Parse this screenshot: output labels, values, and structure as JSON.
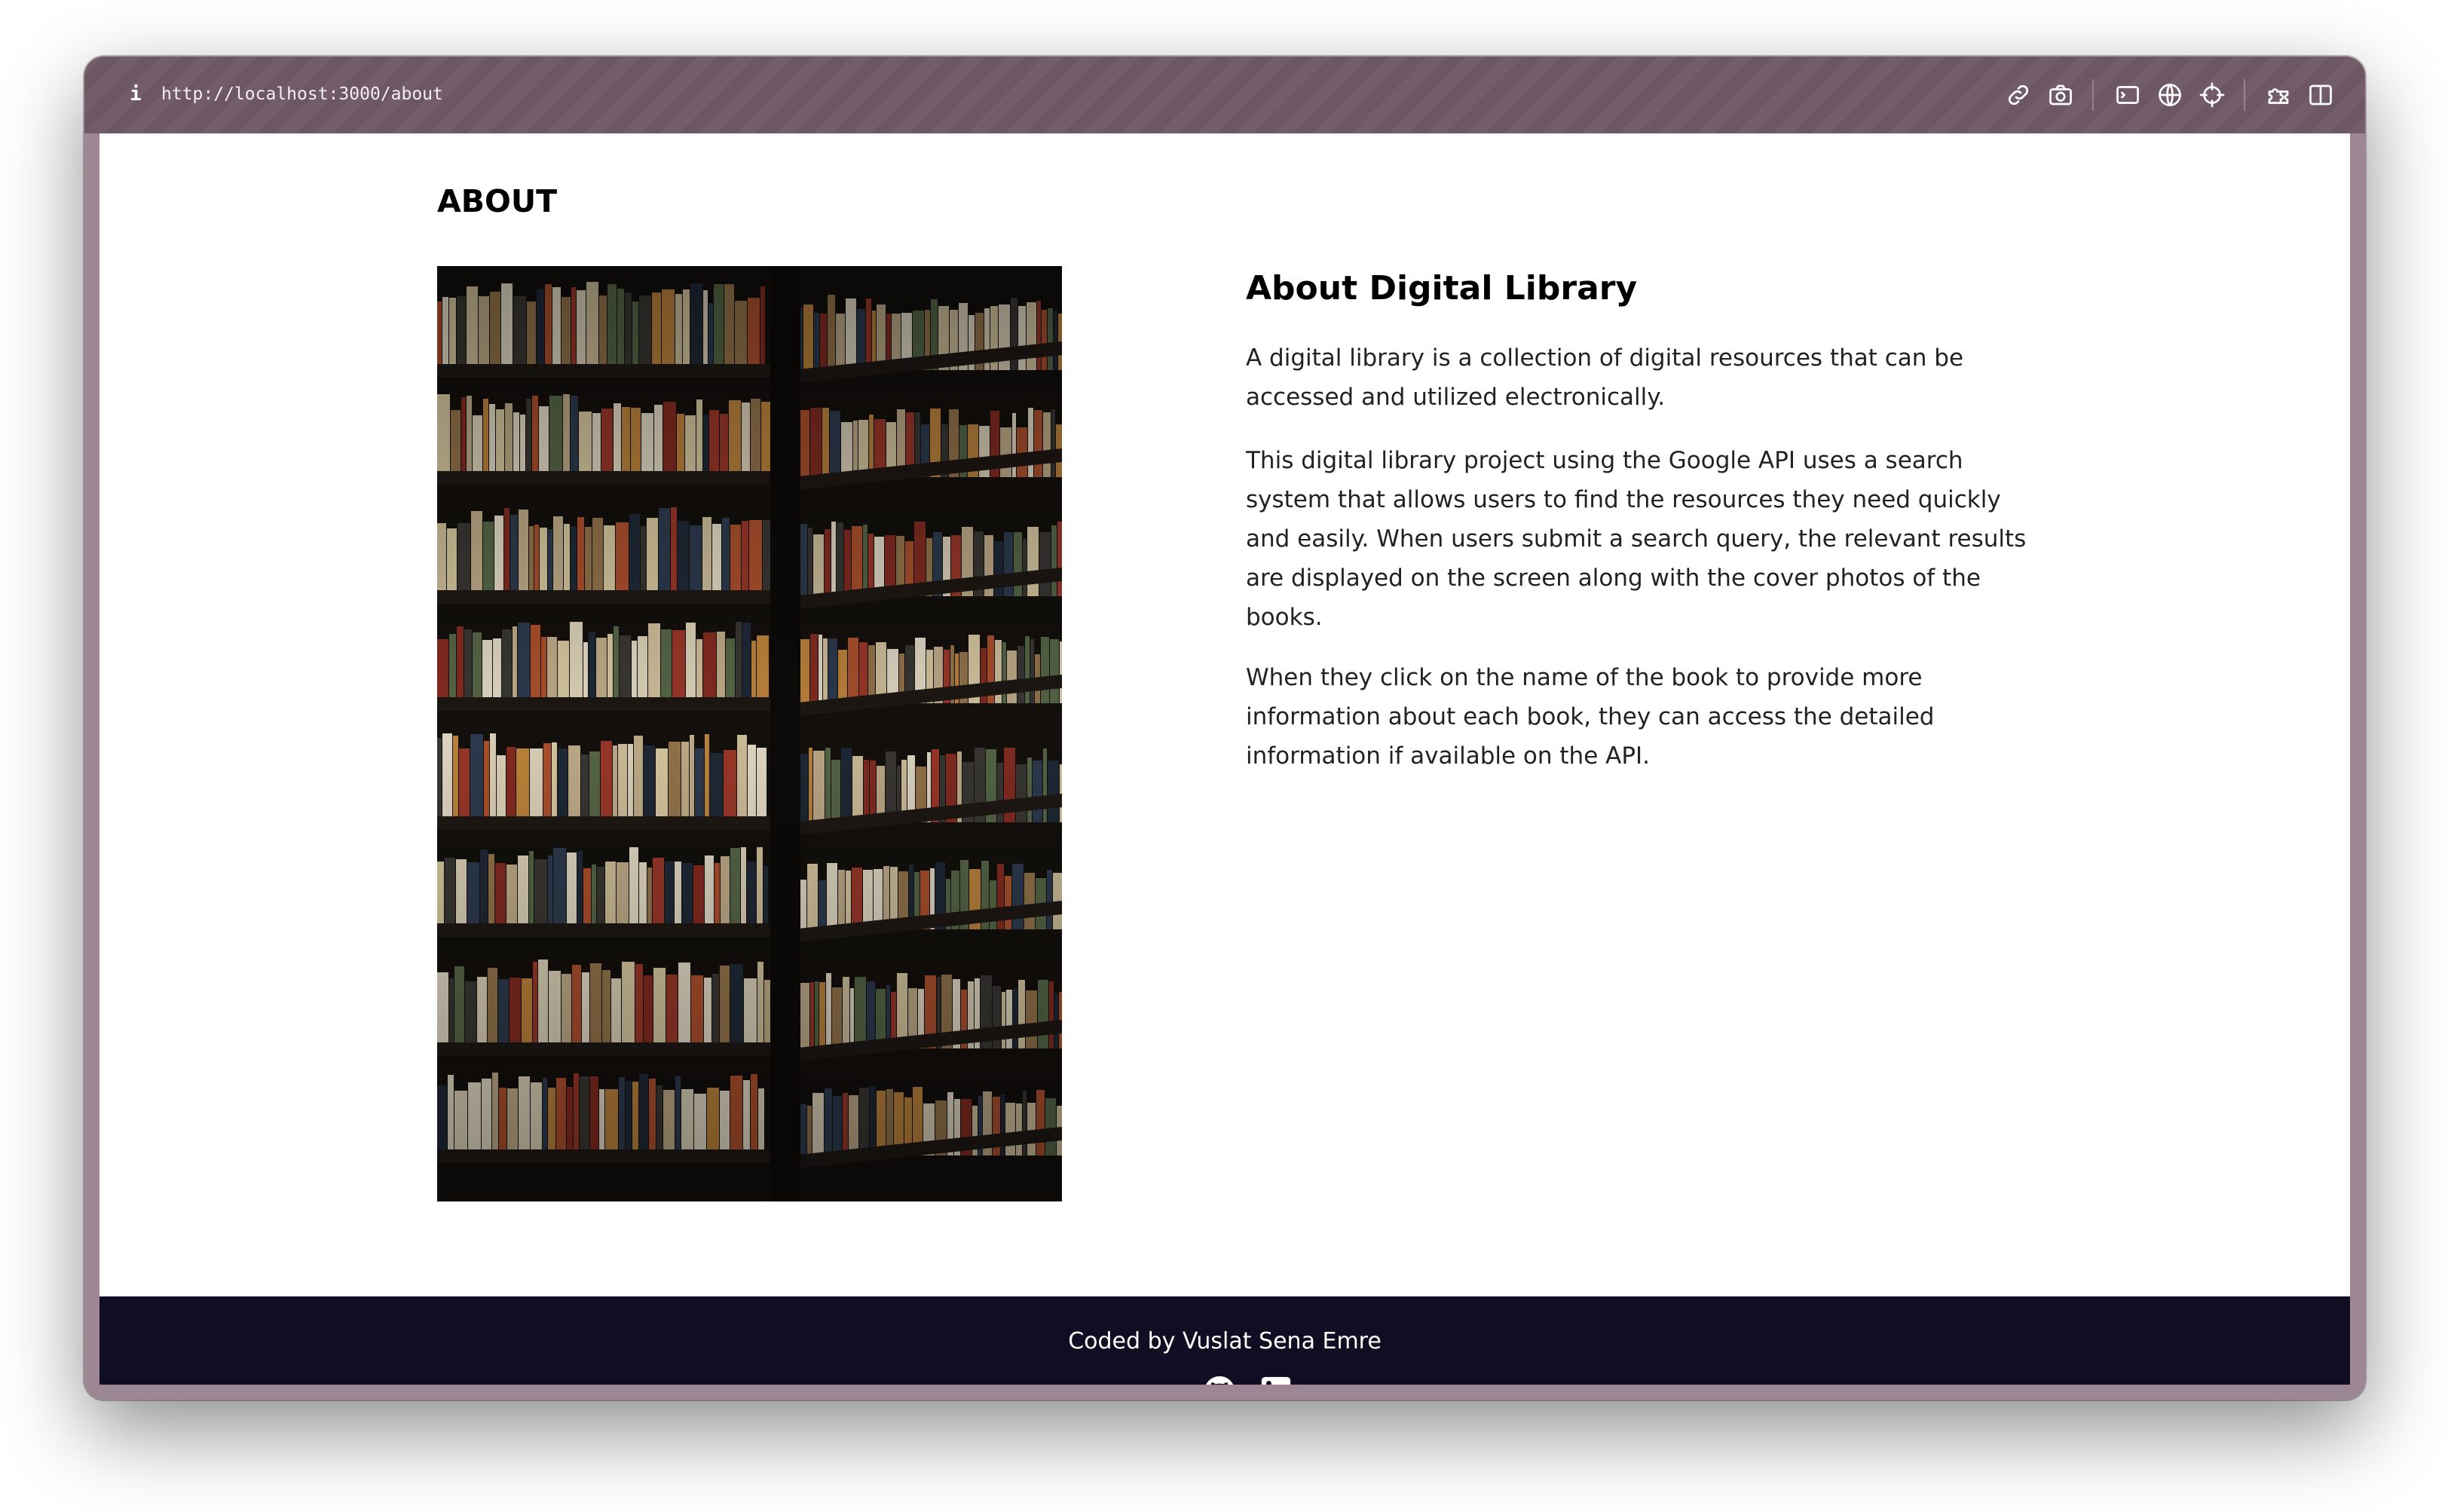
{
  "browser": {
    "info_icon": "info-icon",
    "url": "http://localhost:3000/about",
    "toolbar_icons": [
      "link-icon",
      "camera-icon",
      "terminal-icon",
      "globe-icon",
      "crosshair-icon",
      "extension-icon",
      "sidebar-icon"
    ]
  },
  "page": {
    "heading": "ABOUT",
    "image_icon": "bookshelf-photo"
  },
  "about": {
    "title": "About Digital Library",
    "paragraph_1": "A digital library is a collection of digital resources that can be accessed and utilized electronically.",
    "paragraph_2": "This digital library project using the Google API uses a search system that allows users to find the resources they need quickly and easily. When users submit a search query, the relevant results are displayed on the screen along with the cover photos of the books.",
    "paragraph_3": "When they click on the name of the book to provide more information about each book, they can access the detailed information if available on the API."
  },
  "footer": {
    "credit": "Coded by Vuslat Sena Emre",
    "links": [
      "github-icon",
      "linkedin-icon"
    ]
  },
  "colors": {
    "browser_chrome": "#735d6a",
    "footer_background": "#0f0e23",
    "heading_text": "#000000",
    "body_text": "#222222"
  }
}
